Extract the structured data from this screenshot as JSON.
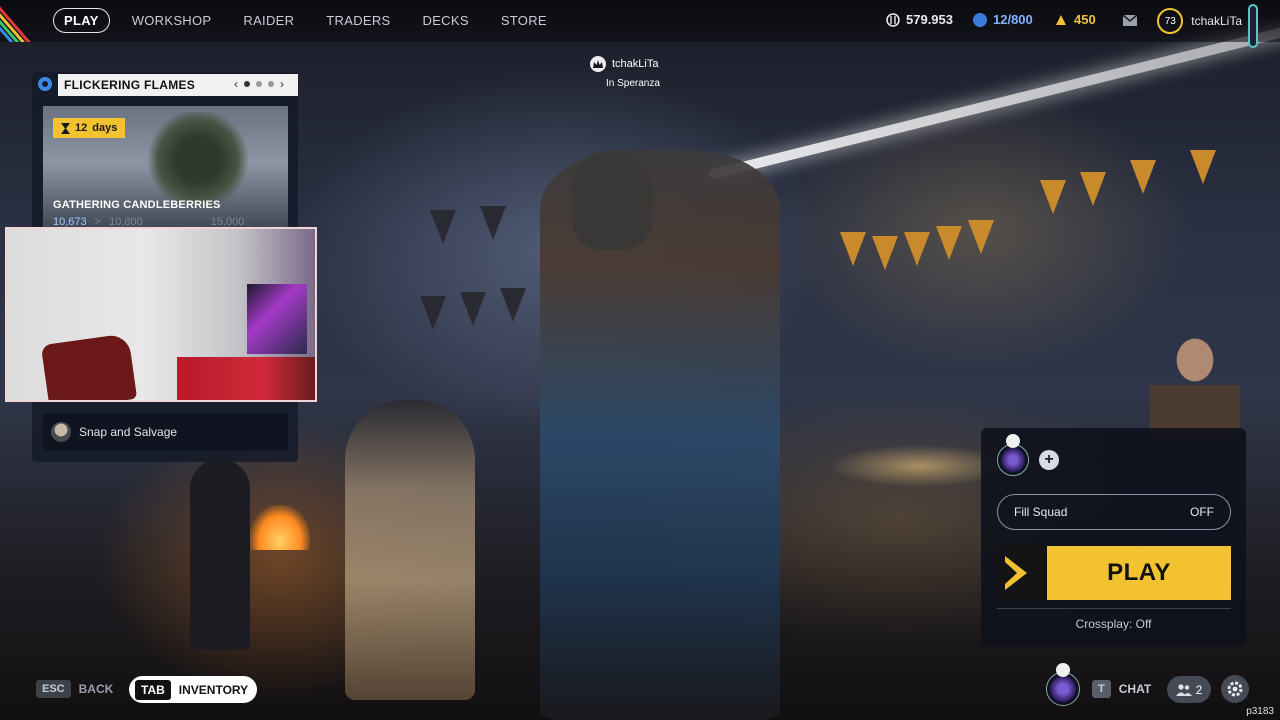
{
  "nav": {
    "items": [
      "PLAY",
      "WORKSHOP",
      "RAIDER",
      "TRADERS",
      "DECKS",
      "STORE"
    ],
    "active_index": 0
  },
  "currencies": {
    "credits": "579.953",
    "raider_tokens": "12/800",
    "cred": "450"
  },
  "profile": {
    "level": "73",
    "username": "tchakLiTa"
  },
  "event": {
    "title": "FLICKERING FLAMES",
    "pager_prev": "‹",
    "pager_next": "›",
    "pages": 3,
    "current_page": 1,
    "days_left": "12",
    "days_unit": "days",
    "card_title": "GATHERING CANDLEBERRIES",
    "progress_current": "10,673",
    "progress_next": "10,800",
    "progress_max": "15,000",
    "quest_label": "Snap and Salvage"
  },
  "player": {
    "name": "tchakLiTa",
    "status": "In Speranza"
  },
  "play_panel": {
    "add_symbol": "+",
    "fill_squad_label": "Fill Squad",
    "fill_squad_value": "OFF",
    "play_label": "PLAY",
    "crossplay": "Crossplay: Off"
  },
  "bottom": {
    "back_key": "ESC",
    "back_label": "BACK",
    "inventory_key": "TAB",
    "inventory_label": "INVENTORY",
    "chat_key": "T",
    "chat_label": "CHAT",
    "friends_count": "2",
    "build_id": "p3183"
  },
  "colors": {
    "accent_yellow": "#f2c230",
    "panel_dark": "#0e121c",
    "progress_blue": "#9fc8ff"
  }
}
